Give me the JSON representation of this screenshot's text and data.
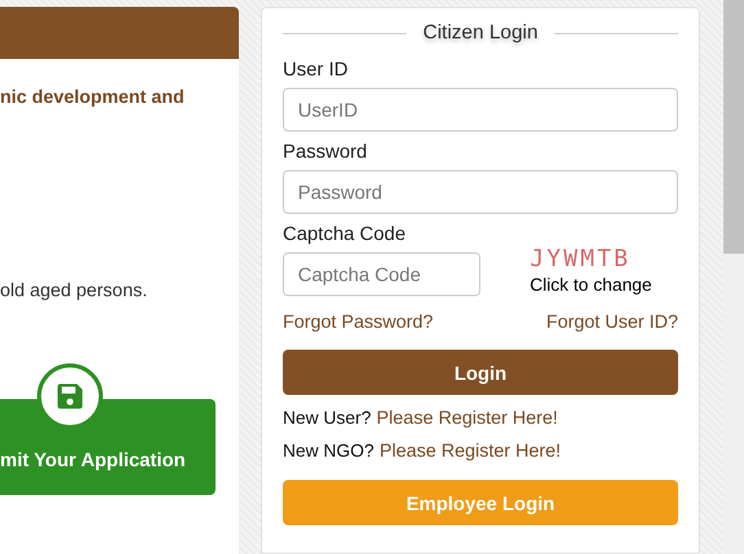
{
  "left_panel": {
    "heading_text": "nic development and",
    "body_text": "old aged persons.",
    "submit_button": "mit Your Application"
  },
  "login": {
    "title": "Citizen Login",
    "fields": [
      {
        "label": "User ID",
        "placeholder": "UserID",
        "kind": "text"
      },
      {
        "label": "Password",
        "placeholder": "Password",
        "kind": "password"
      },
      {
        "label": "Captcha Code",
        "placeholder": "Captcha Code",
        "kind": "captcha"
      }
    ],
    "captcha": {
      "code": "JYWMTB",
      "refresh_text": "Click to change"
    },
    "forgot_password": "Forgot Password?",
    "forgot_user_id": "Forgot User ID?",
    "login_button": "Login",
    "register_lines": [
      {
        "prompt": "New User?",
        "link": "Please Register Here!"
      },
      {
        "prompt": "New NGO?",
        "link": "Please Register Here!"
      }
    ],
    "employee_button": "Employee Login"
  }
}
